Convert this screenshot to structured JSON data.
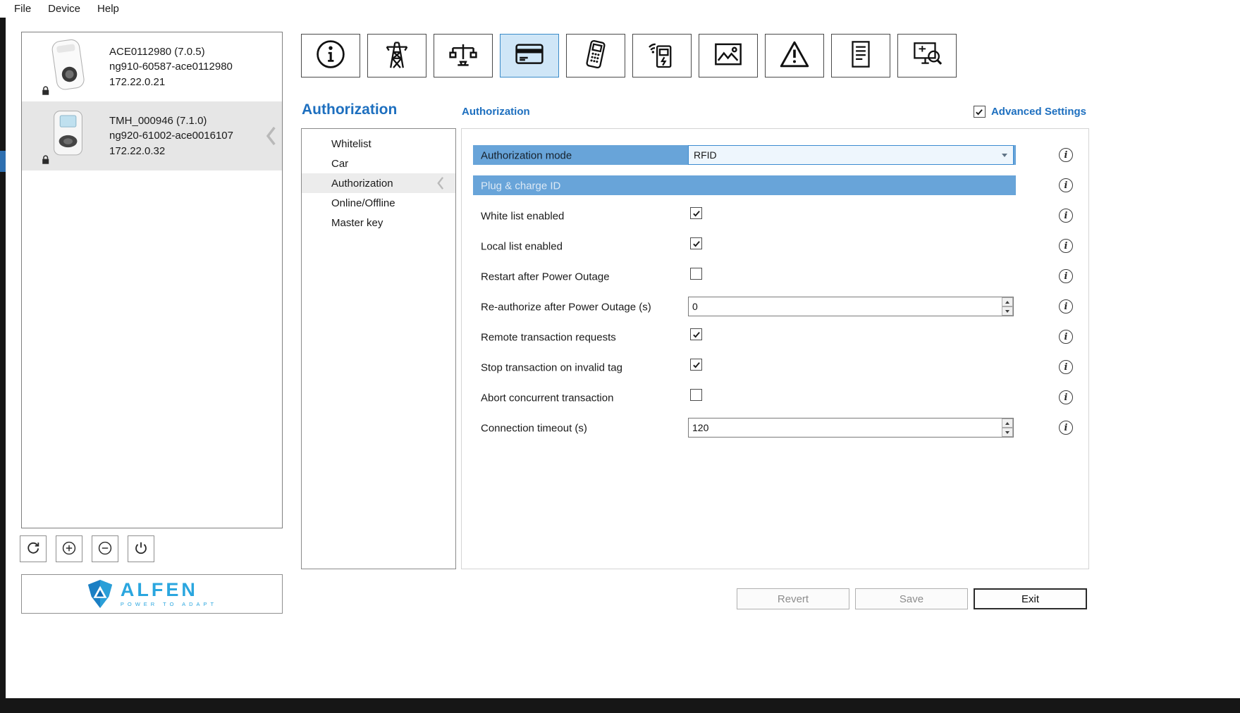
{
  "window": {
    "menu": [
      "File",
      "Device",
      "Help"
    ]
  },
  "device_panel": {
    "devices": [
      {
        "name": "ACE0112980 (7.0.5)",
        "id": "ng910-60587-ace0112980",
        "ip": "172.22.0.21",
        "image": "wallbox-charger",
        "selected": false,
        "locked": true,
        "chevron": false
      },
      {
        "name": "TMH_000946 (7.1.0)",
        "id": "ng920-61002-ace0016107",
        "ip": "172.22.0.32",
        "image": "display-charger",
        "selected": true,
        "locked": true,
        "chevron": true
      }
    ],
    "actions": [
      {
        "name": "refresh-device-button",
        "icon": "refresh"
      },
      {
        "name": "add-device-button",
        "icon": "plus-circle"
      },
      {
        "name": "remove-device-button",
        "icon": "minus-circle"
      },
      {
        "name": "reboot-device-button",
        "icon": "power"
      }
    ],
    "logo": {
      "brand": "ALFEN",
      "tagline": "POWER TO ADAPT",
      "color": "#2aa6df"
    }
  },
  "toolbar": {
    "icons": [
      {
        "name": "tab-general-info",
        "icon": "info",
        "selected": false
      },
      {
        "name": "tab-power-grid",
        "icon": "pylon",
        "selected": false
      },
      {
        "name": "tab-load-balancing",
        "icon": "load-balancing",
        "selected": false
      },
      {
        "name": "tab-authorization",
        "icon": "credit-card",
        "selected": true
      },
      {
        "name": "tab-payment-terminal",
        "icon": "payment-terminal",
        "selected": false
      },
      {
        "name": "tab-connectivity",
        "icon": "charge-point-wifi",
        "selected": false
      },
      {
        "name": "tab-display",
        "icon": "picture",
        "selected": false
      },
      {
        "name": "tab-errors",
        "icon": "warning",
        "selected": false
      },
      {
        "name": "tab-logs",
        "icon": "document",
        "selected": false
      },
      {
        "name": "tab-diagnostics",
        "icon": "monitor-search",
        "selected": false
      }
    ]
  },
  "page": {
    "title": "Authorization",
    "section_title": "Authorization",
    "advanced_settings_label": "Advanced Settings",
    "advanced_settings_checked": true
  },
  "subnav": {
    "items": [
      {
        "label": "Whitelist",
        "selected": false
      },
      {
        "label": "Car",
        "selected": false
      },
      {
        "label": "Authorization",
        "selected": true
      },
      {
        "label": "Online/Offline",
        "selected": false
      },
      {
        "label": "Master key",
        "selected": false
      }
    ]
  },
  "form": {
    "rows": [
      {
        "label": "Authorization mode",
        "type": "select",
        "value": "RFID"
      },
      {
        "label": "Plug & charge ID",
        "type": "disabled_bar"
      },
      {
        "label": "White list enabled",
        "type": "checkbox",
        "checked": true
      },
      {
        "label": "Local list enabled",
        "type": "checkbox",
        "checked": true
      },
      {
        "label": "Restart after Power Outage",
        "type": "checkbox",
        "checked": false
      },
      {
        "label": "Re-authorize after Power Outage (s)",
        "type": "number",
        "value": "0"
      },
      {
        "label": "Remote transaction requests",
        "type": "checkbox",
        "checked": true
      },
      {
        "label": "Stop transaction on invalid tag",
        "type": "checkbox",
        "checked": true
      },
      {
        "label": "Abort concurrent transaction",
        "type": "checkbox",
        "checked": false
      },
      {
        "label": "Connection timeout (s)",
        "type": "number",
        "value": "120"
      }
    ]
  },
  "footer": {
    "revert": "Revert",
    "save": "Save",
    "exit": "Exit"
  },
  "colors": {
    "accent_blue": "#1d6fbf",
    "highlight_blue": "#68a4d9",
    "selected_tab_bg": "#cfe6f7"
  }
}
